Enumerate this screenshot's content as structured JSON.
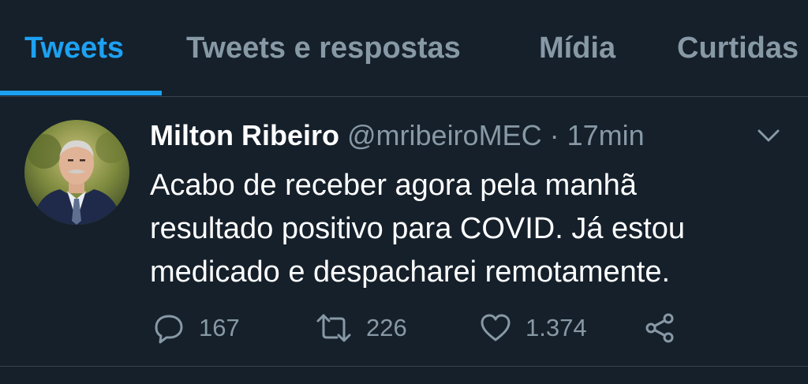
{
  "tabs": [
    {
      "label": "Tweets",
      "active": true
    },
    {
      "label": "Tweets e respostas",
      "active": false
    },
    {
      "label": "Mídia",
      "active": false
    },
    {
      "label": "Curtidas",
      "active": false
    }
  ],
  "tweet": {
    "author_name": "Milton Ribeiro",
    "handle": "@mribeiroMEC",
    "separator": "·",
    "time": "17min",
    "text_lines": [
      "Acabo de receber agora pela manhã",
      "resultado positivo para COVID. Já estou",
      "medicado e despacharei remotamente."
    ],
    "reply_count": "167",
    "retweet_count": "226",
    "like_count": "1.374"
  },
  "icons": {
    "reply": "reply-icon",
    "retweet": "retweet-icon",
    "like": "heart-icon",
    "share": "share-icon",
    "menu": "chevron-down-icon"
  },
  "colors": {
    "background": "#15202b",
    "accent": "#1da1f2",
    "secondary_text": "#8899a6",
    "border": "#38444d"
  }
}
